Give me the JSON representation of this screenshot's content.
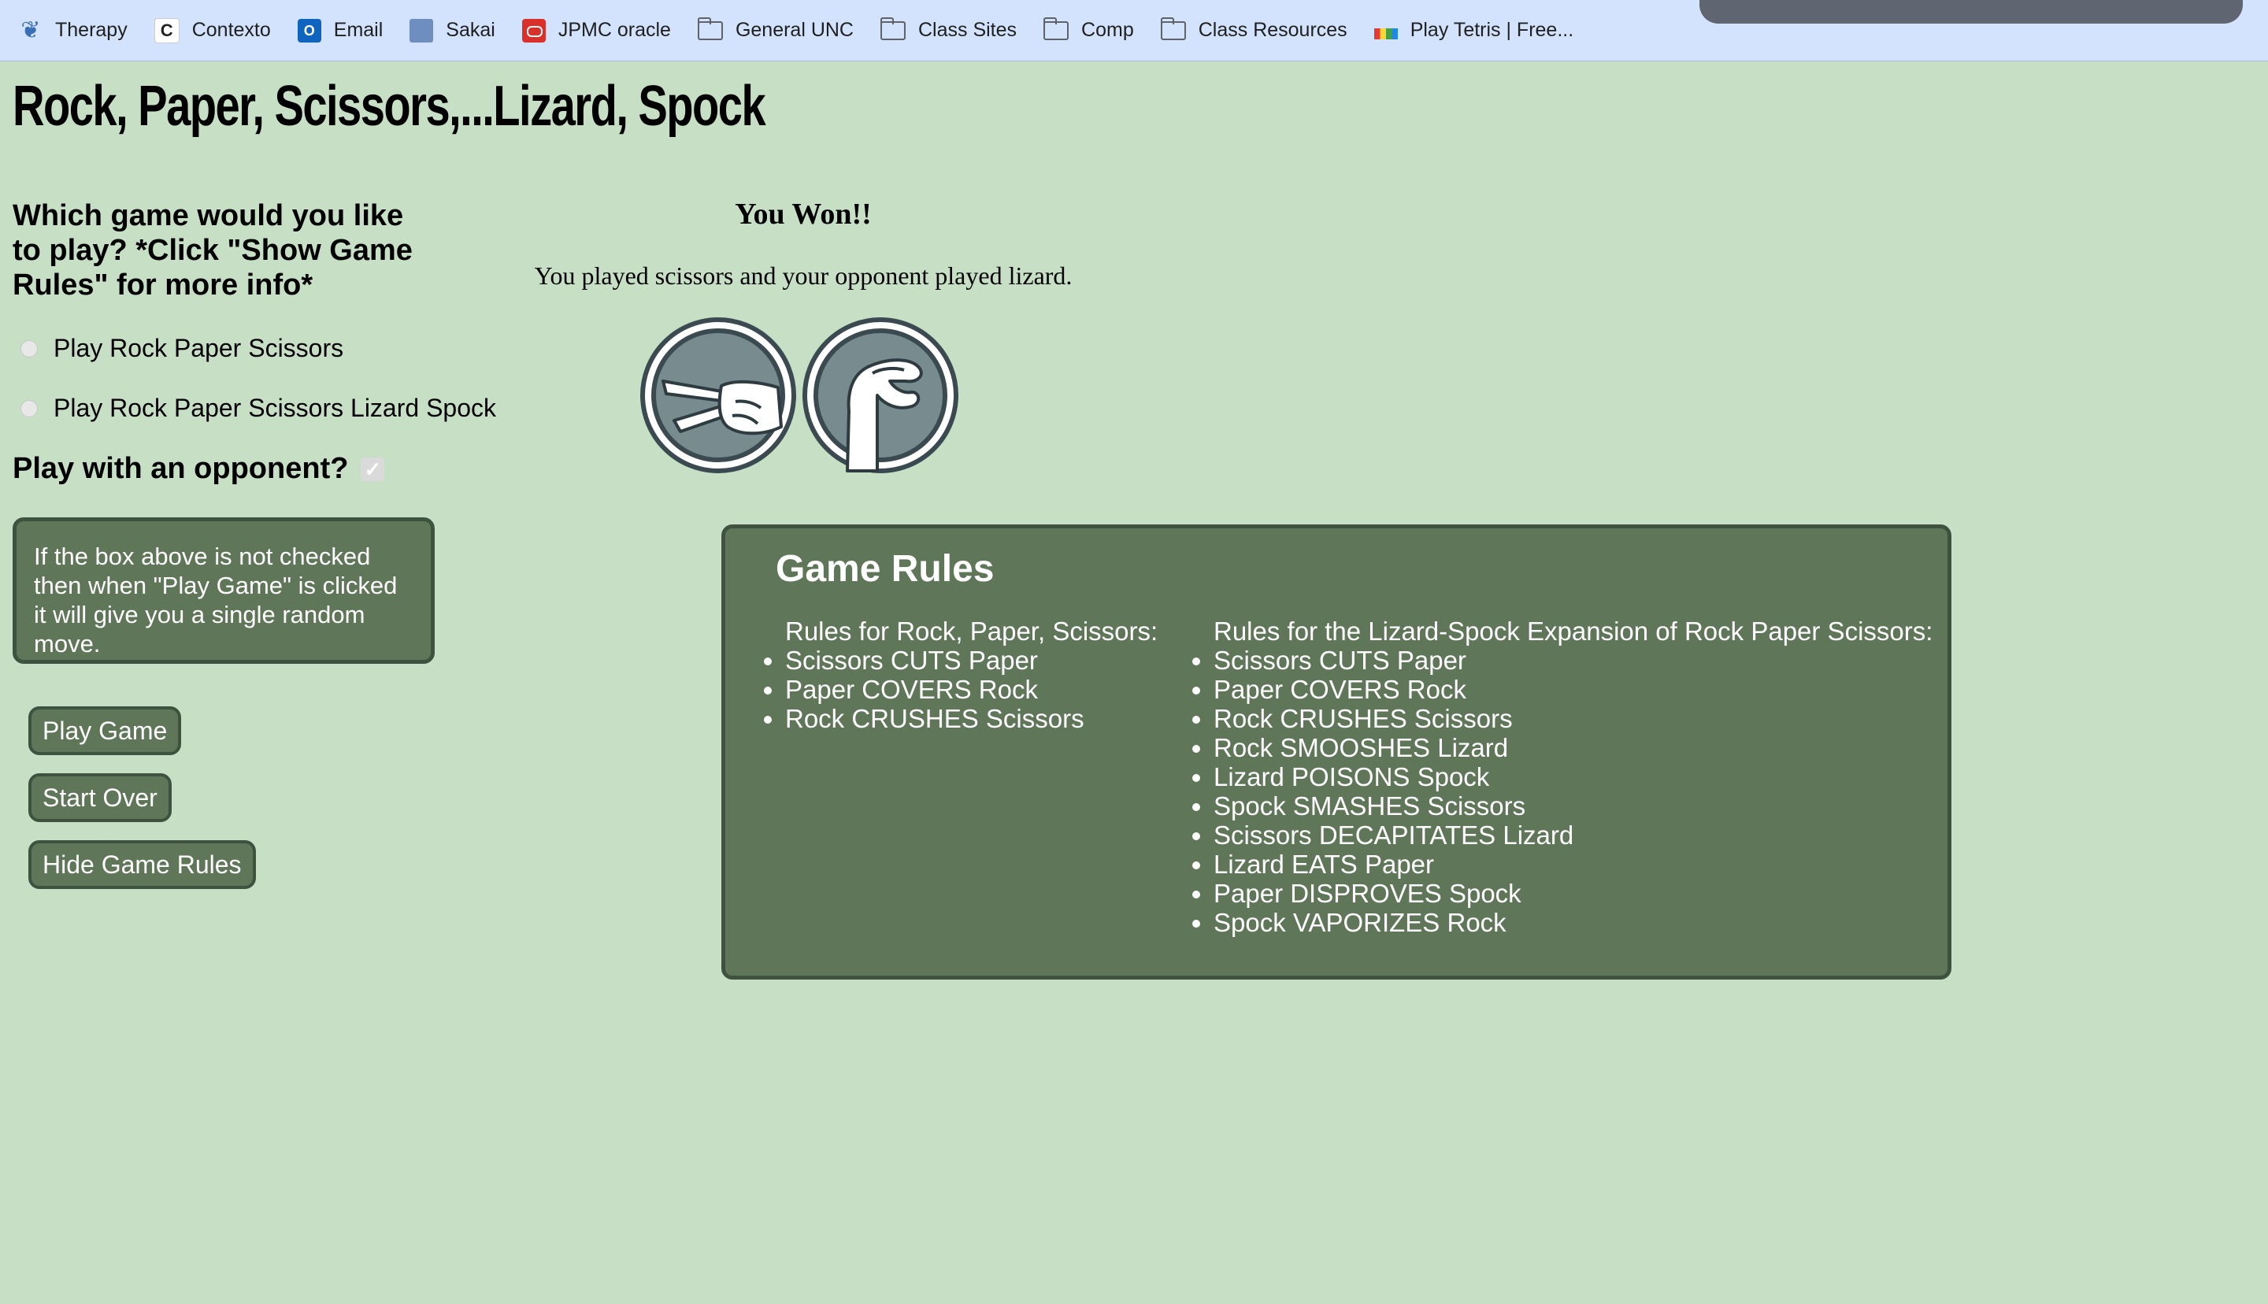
{
  "bookmarks": [
    {
      "label": "Therapy",
      "icon": "butterfly-icon"
    },
    {
      "label": "Contexto",
      "icon": "contexto-icon"
    },
    {
      "label": "Email",
      "icon": "outlook-icon"
    },
    {
      "label": "Sakai",
      "icon": "sakai-icon"
    },
    {
      "label": "JPMC oracle",
      "icon": "oracle-icon"
    },
    {
      "label": "General UNC",
      "icon": "folder-icon"
    },
    {
      "label": "Class Sites",
      "icon": "folder-icon"
    },
    {
      "label": "Comp",
      "icon": "folder-icon"
    },
    {
      "label": "Class Resources",
      "icon": "folder-icon"
    },
    {
      "label": "Play Tetris | Free...",
      "icon": "tetris-icon"
    }
  ],
  "page": {
    "title": "Rock, Paper, Scissors,...Lizard, Spock",
    "question": "Which game would you like to play? *Click \"Show Game Rules\" for more info*",
    "options": [
      {
        "label": "Play Rock Paper Scissors",
        "selected": false
      },
      {
        "label": "Play Rock Paper Scissors Lizard Spock",
        "selected": false
      }
    ],
    "opponent_label": "Play with an opponent?",
    "opponent_checked": true,
    "note": "If the box above is not checked then when \"Play Game\" is clicked it will give you a single random move.",
    "buttons": {
      "play": "Play Game",
      "start_over": "Start Over",
      "hide_rules": "Hide Game Rules"
    }
  },
  "result": {
    "title": "You Won!!",
    "text": "You played scissors and your opponent played lizard.",
    "player_move": "scissors",
    "opponent_move": "lizard"
  },
  "rules": {
    "title": "Game Rules",
    "rps_heading": "Rules for Rock, Paper, Scissors:",
    "rps": [
      "Scissors CUTS Paper",
      "Paper COVERS Rock",
      "Rock CRUSHES Scissors"
    ],
    "rpsls_heading": "Rules for the Lizard-Spock Expansion of Rock Paper Scissors:",
    "rpsls": [
      "Scissors CUTS Paper",
      "Paper COVERS Rock",
      "Rock CRUSHES Scissors",
      "Rock SMOOSHES Lizard",
      "Lizard POISONS Spock",
      "Spock SMASHES Scissors",
      "Scissors DECAPITATES Lizard",
      "Lizard EATS Paper",
      "Paper DISPROVES Spock",
      "Spock VAPORIZES Rock"
    ]
  },
  "colors": {
    "page_bg": "#c7e0c5",
    "panel": "#5f7659",
    "panel_border": "#3f5240",
    "hand_bg": "#788c8f"
  }
}
